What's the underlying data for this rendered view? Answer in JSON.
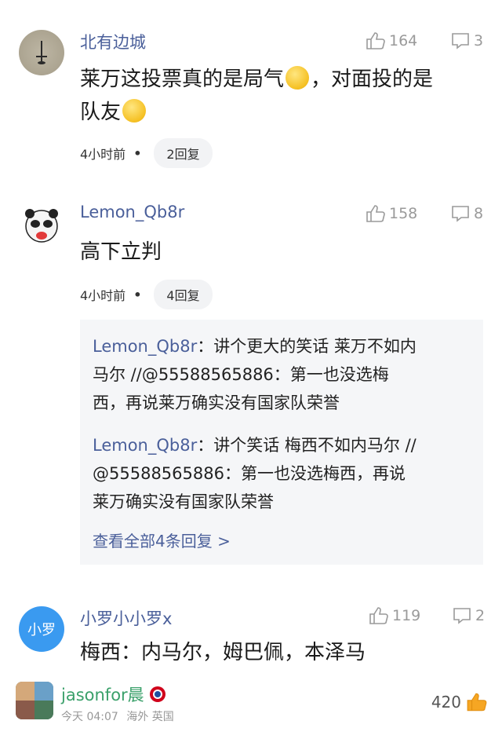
{
  "comments": [
    {
      "username": "北有边城",
      "likes": "164",
      "replies_count": "3",
      "text_part1": "莱万这投票真的是局气",
      "text_part2": "，对面投的是",
      "text_part3": "队友",
      "time": "4小时前",
      "reply_label": "2回复"
    },
    {
      "username": "Lemon_Qb8r",
      "likes": "158",
      "replies_count": "8",
      "text": "高下立判",
      "time": "4小时前",
      "reply_label": "4回复"
    },
    {
      "username": "小罗小小罗x",
      "avatar_text": "小罗",
      "likes": "119",
      "replies_count": "2",
      "text": "梅西：内马尔，姆巴佩，本泽马"
    }
  ],
  "sub_replies": [
    {
      "user": "Lemon_Qb8r",
      "line1": "：讲个更大的笑话 莱万不如内",
      "line2": "马尔 //@55588565886：第一也没选梅",
      "line3": "西，再说莱万确实没有国家队荣誉"
    },
    {
      "user": "Lemon_Qb8r",
      "line1": "：讲个笑话 梅西不如内马尔 //",
      "line2": "@55588565886：第一也没选梅西，再说",
      "line3": "莱万确实没有国家队荣誉"
    }
  ],
  "see_all": "查看全部4条回复 >",
  "footer": {
    "username": "jasonfor晨",
    "time": "今天 04:07",
    "region": "海外 英国",
    "likes": "420"
  },
  "colors": {
    "username": "#4a5f9a",
    "footer_username": "#3aa06a",
    "avatar_blue": "#3a9af0"
  }
}
